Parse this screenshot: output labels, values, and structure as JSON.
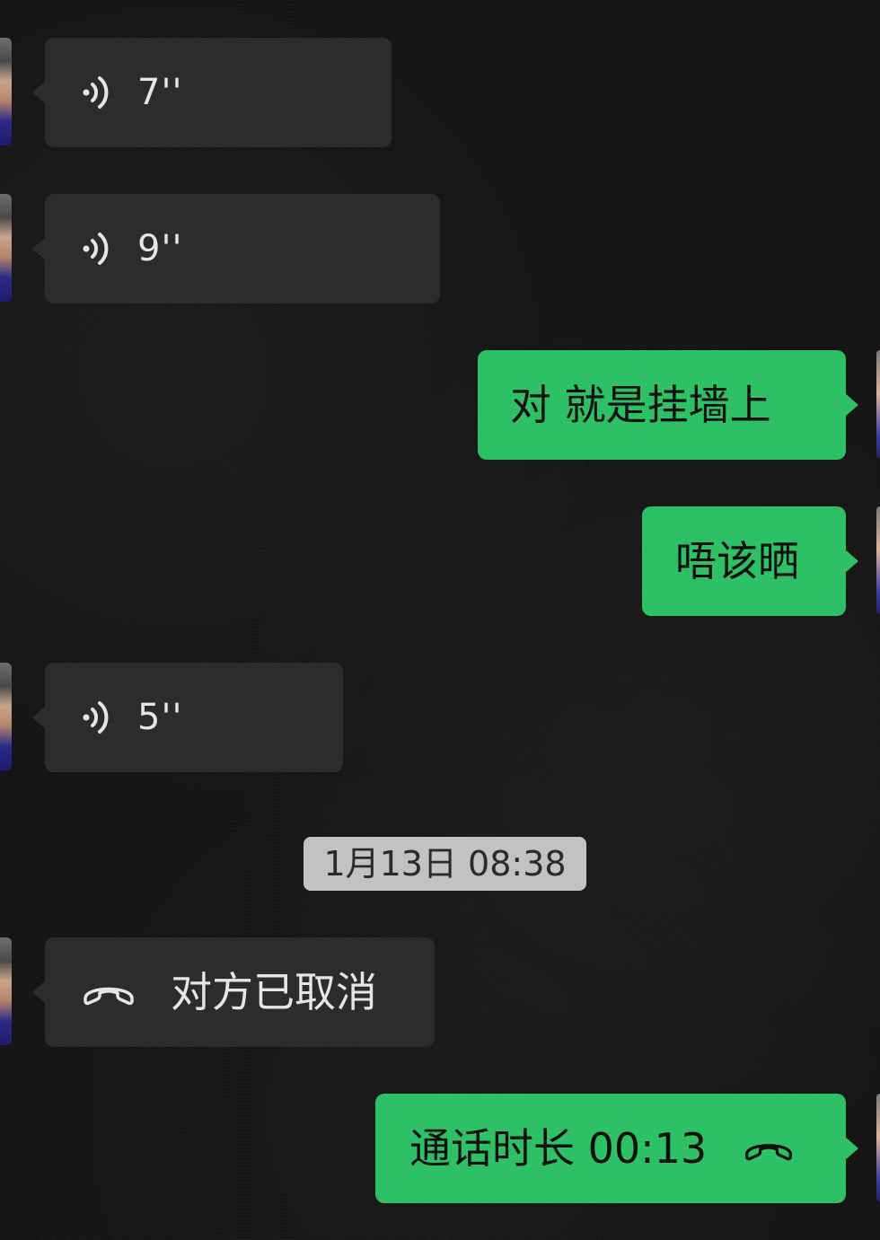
{
  "messages": {
    "voice_1": "7''",
    "voice_2": "9''",
    "text_1": "对 就是挂墙上",
    "text_2": "唔该晒",
    "voice_3": "5''",
    "call_cancelled": "对方已取消",
    "call_duration": "通话时长 00:13"
  },
  "timestamp": "1月13日 08:38",
  "icons": {
    "voice": "voice-wave-icon",
    "call": "phone-hangup-icon"
  },
  "colors": {
    "background": "#141414",
    "incoming_bubble": "#2c2c2c",
    "outgoing_bubble": "#2ec065",
    "timestamp_bg": "#c2c2c2"
  }
}
